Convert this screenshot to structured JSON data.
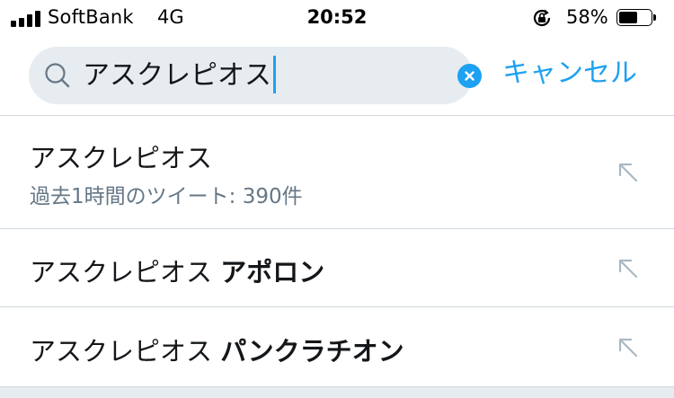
{
  "status_bar": {
    "carrier": "SoftBank",
    "network": "4G",
    "time": "20:52",
    "battery_percent": "58%",
    "battery_level": 0.58
  },
  "search": {
    "query": "アスクレピオス",
    "cancel_label": "キャンセル",
    "accent_color": "#1da1f2"
  },
  "suggestions": [
    {
      "text": "アスクレピオス",
      "bold": "",
      "meta": "過去1時間のツイート: 390件"
    },
    {
      "text": "アスクレピオス ",
      "bold": "アポロン",
      "meta": ""
    },
    {
      "text": "アスクレピオス ",
      "bold": "パンクラチオン",
      "meta": ""
    }
  ]
}
